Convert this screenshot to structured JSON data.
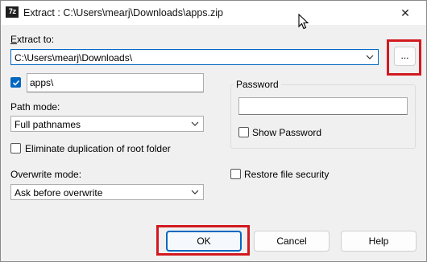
{
  "window": {
    "title": "Extract : C:\\Users\\mearj\\Downloads\\apps.zip",
    "app_icon_text": "7z",
    "close_glyph": "✕"
  },
  "extract_to": {
    "label_mnemonic": "E",
    "label_rest": "xtract to:",
    "path": "C:\\Users\\mearj\\Downloads\\",
    "browse_label": "..."
  },
  "subfolder": {
    "checked": true,
    "value": "apps\\"
  },
  "path_mode": {
    "label": "Path mode:",
    "selected": "Full pathnames"
  },
  "eliminate_duplication": {
    "label": "Eliminate duplication of root folder",
    "checked": false
  },
  "overwrite_mode": {
    "label": "Overwrite mode:",
    "selected": "Ask before overwrite"
  },
  "password": {
    "group_label": "Password",
    "value": "",
    "show_password_label": "Show Password",
    "show_password_checked": false
  },
  "restore_security": {
    "label": "Restore file security",
    "checked": false
  },
  "buttons": {
    "ok": "OK",
    "cancel": "Cancel",
    "help": "Help"
  },
  "colors": {
    "accent": "#0067c0",
    "highlight": "#d3191f"
  }
}
